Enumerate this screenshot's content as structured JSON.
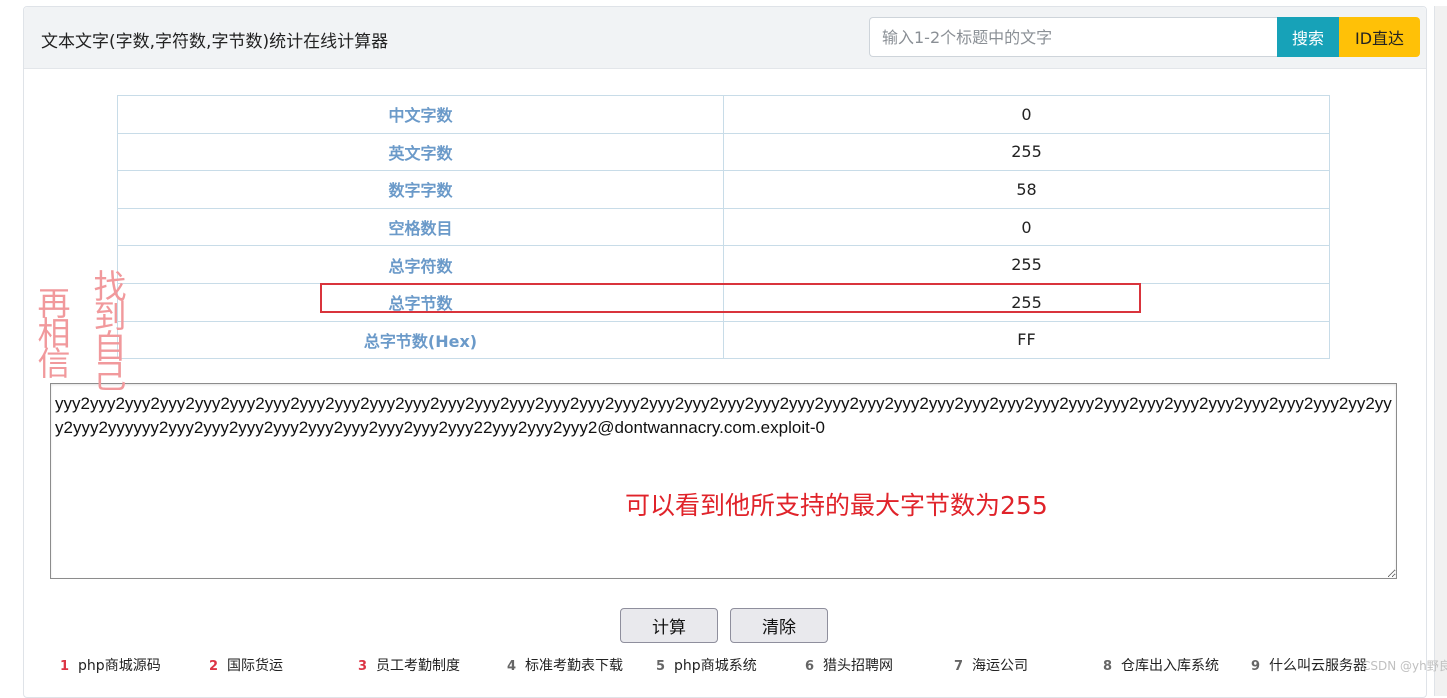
{
  "header": {
    "title": "文本文字(字数,字符数,字节数)统计在线计算器",
    "search_placeholder": "输入1-2个标题中的文字",
    "search_button": "搜索",
    "id_button": "ID直达"
  },
  "stats": [
    {
      "label": "中文字数",
      "value": "0"
    },
    {
      "label": "英文字数",
      "value": "255"
    },
    {
      "label": "数字字数",
      "value": "58"
    },
    {
      "label": "空格数目",
      "value": "0"
    },
    {
      "label": "总字符数",
      "value": "255"
    },
    {
      "label": "总字节数",
      "value": "255"
    },
    {
      "label": "总字节数(Hex)",
      "value": "FF"
    }
  ],
  "overlay": {
    "vertical_left": [
      "再",
      "相",
      "信"
    ],
    "vertical_right": [
      "找",
      "到",
      "自",
      "己"
    ],
    "annotation": "可以看到他所支持的最大字节数为255",
    "highlight_color": "#d9343c"
  },
  "input_text": "yyy2yyy2yyy2yyy2yyy2yyy2yyy2yyy2yyy2yyy2yyy2yyy2yyy2yyy2yyy2yyy2yyy2yyy2yyy2yyy2yyy2yyy2yyy2yyy2yyy2yyy2yyy2yyy2yyy2yyy2yyy2yyy2yyy2yyy2yyy2yyy2yyy2yy2yyy2yyy2yyyyyy2yyy2yyy2yyy2yyy2yyy2yyy2yyy2yyy2yyy22yyy2yyy2yyy2@dontwannacry.com.exploit-0",
  "buttons": {
    "calculate": "计算",
    "clear": "清除"
  },
  "related_links": [
    {
      "num": "1",
      "label": "php商城源码",
      "num_color": "#dc3545"
    },
    {
      "num": "2",
      "label": "国际货运",
      "num_color": "#dc3545"
    },
    {
      "num": "3",
      "label": "员工考勤制度",
      "num_color": "#dc3545"
    },
    {
      "num": "4",
      "label": "标准考勤表下载",
      "num_color": "#666666"
    },
    {
      "num": "5",
      "label": "php商城系统",
      "num_color": "#666666"
    },
    {
      "num": "6",
      "label": "猎头招聘网",
      "num_color": "#666666"
    },
    {
      "num": "7",
      "label": "海运公司",
      "num_color": "#666666"
    },
    {
      "num": "8",
      "label": "仓库出入库系统",
      "num_color": "#666666"
    },
    {
      "num": "9",
      "label": "什么叫云服务器",
      "num_color": "#666666"
    }
  ],
  "watermark": "CSDN @yh野良",
  "colors": {
    "search_button_bg": "#17a2b8",
    "id_button_bg": "#ffc107",
    "label_text": "#6b9ac9",
    "annotation_text": "#e0232a"
  }
}
